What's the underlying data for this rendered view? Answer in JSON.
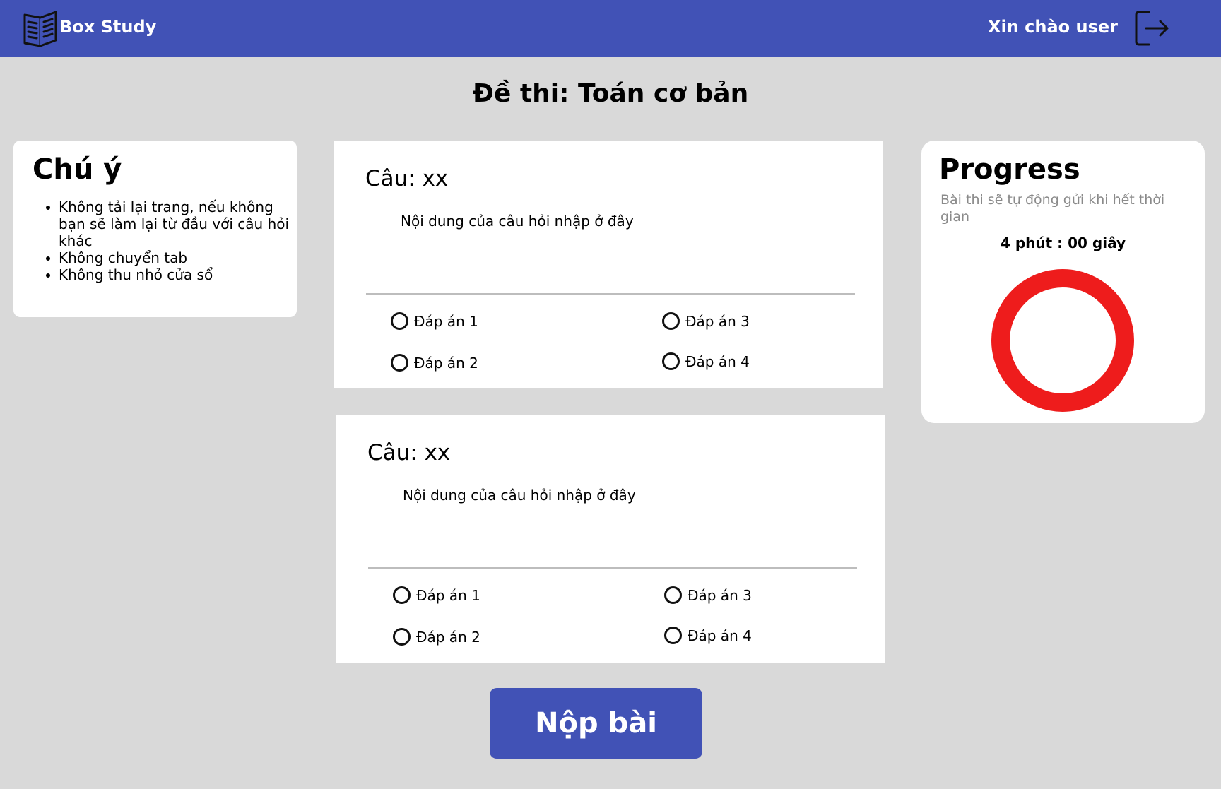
{
  "header": {
    "brand": "Box Study",
    "greeting": "Xin chào user",
    "logo_icon": "open-book-icon",
    "logout_icon": "logout-icon",
    "background": "#4152b6"
  },
  "exam_title": "Đề thi: Toán cơ bản",
  "notice": {
    "title": "Chú ý",
    "items": [
      "Không tải lại trang, nếu không bạn sẽ làm lại từ đầu với câu hỏi khác",
      "Không chuyển tab",
      "Không thu nhỏ cửa sổ"
    ]
  },
  "questions": [
    {
      "label": "Câu: xx",
      "content": "Nội dung của câu hỏi nhập ở đây",
      "options": [
        "Đáp án 1",
        "Đáp án 2",
        "Đáp án 3",
        "Đáp án 4"
      ]
    },
    {
      "label": "Câu: xx",
      "content": "Nội dung của câu hỏi nhập ở đây",
      "options": [
        "Đáp án 1",
        "Đáp án 2",
        "Đáp án 3",
        "Đáp án 4"
      ]
    }
  ],
  "progress": {
    "title": "Progress",
    "note": "Bài thi sẽ tự động gửi khi hết thời gian",
    "timer": "4 phút : 00 giây",
    "ring_color": "#ee1c1c",
    "ring_fill_fraction": 1.0
  },
  "submit_label": "Nộp bài"
}
